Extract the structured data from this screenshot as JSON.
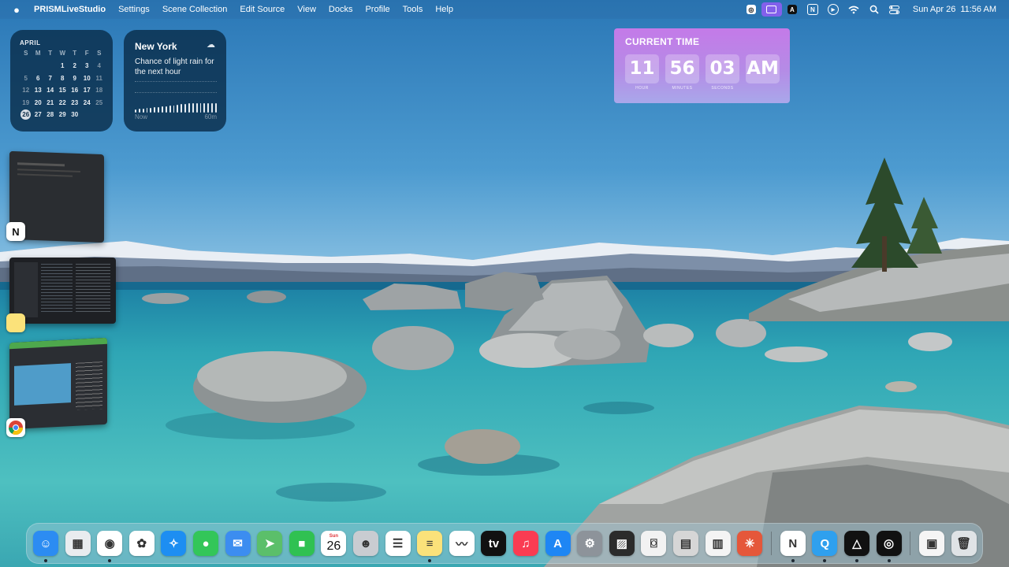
{
  "menubar": {
    "apple_icon": "apple-logo",
    "app_name": "PRISMLiveStudio",
    "items": [
      "Settings",
      "Scene Collection",
      "Edit Source",
      "View",
      "Docks",
      "Profile",
      "Tools",
      "Help"
    ],
    "status_icons": [
      "prism-icon",
      "screen-share-icon",
      "adobe-icon",
      "notion-icon",
      "play-circle-icon",
      "wifi-icon",
      "search-icon",
      "control-center-icon"
    ],
    "date": "Sun Apr 26",
    "time": "11:56 AM"
  },
  "calendar_widget": {
    "month": "APRIL",
    "weekdays": [
      "S",
      "M",
      "T",
      "W",
      "T",
      "F",
      "S"
    ],
    "days": [
      "",
      "",
      "",
      "1",
      "2",
      "3",
      "4",
      "5",
      "6",
      "7",
      "8",
      "9",
      "10",
      "11",
      "12",
      "13",
      "14",
      "15",
      "16",
      "17",
      "18",
      "19",
      "20",
      "21",
      "22",
      "23",
      "24",
      "25",
      "26",
      "27",
      "28",
      "29",
      "30"
    ],
    "today": "26"
  },
  "weather_widget": {
    "city": "New York",
    "forecast": "Chance of light rain for the next hour",
    "icon": "cloud-rain-icon",
    "start_label": "Now",
    "end_label": "60m"
  },
  "clock_widget": {
    "title": "CURRENT TIME",
    "hour": "11",
    "minutes": "56",
    "seconds": "03",
    "ampm": "AM",
    "hour_caption": "HOUR",
    "minutes_caption": "MINUTES",
    "seconds_caption": "SECONDS"
  },
  "stage_manager": {
    "apps": [
      "Notion",
      "Notes",
      "Chrome"
    ]
  },
  "dock": {
    "apps": [
      {
        "name": "Finder",
        "icon": "finder-icon",
        "color": "#2c8cf2",
        "glyph": "☺",
        "running": true
      },
      {
        "name": "Launchpad",
        "icon": "launchpad-icon",
        "color": "#e9ecef",
        "glyph": "▦",
        "running": false
      },
      {
        "name": "Chrome",
        "icon": "chrome-icon",
        "color": "#ffffff",
        "glyph": "◉",
        "running": true
      },
      {
        "name": "Photos",
        "icon": "photos-icon",
        "color": "#ffffff",
        "glyph": "✿",
        "running": false
      },
      {
        "name": "Safari",
        "icon": "safari-icon",
        "color": "#1d8ef2",
        "glyph": "✧",
        "running": false
      },
      {
        "name": "Messages",
        "icon": "messages-icon",
        "color": "#33c659",
        "glyph": "●",
        "running": false
      },
      {
        "name": "Mail",
        "icon": "mail-icon",
        "color": "#3c8df0",
        "glyph": "✉",
        "running": false
      },
      {
        "name": "Maps",
        "icon": "maps-icon",
        "color": "#5bbf6a",
        "glyph": "➤",
        "running": false
      },
      {
        "name": "FaceTime",
        "icon": "facetime-icon",
        "color": "#30c152",
        "glyph": "■",
        "running": false
      },
      {
        "name": "Calendar",
        "icon": "calendar-icon",
        "color": "#ffffff",
        "glyph": "26",
        "month": "Sun",
        "running": false
      },
      {
        "name": "Contacts",
        "icon": "contacts-icon",
        "color": "#c9ccd1",
        "glyph": "☻",
        "running": false
      },
      {
        "name": "Reminders",
        "icon": "reminders-icon",
        "color": "#ffffff",
        "glyph": "☰",
        "running": false
      },
      {
        "name": "Notes",
        "icon": "notes-icon",
        "color": "#fbe27a",
        "glyph": "≡",
        "running": true
      },
      {
        "name": "Freeform",
        "icon": "freeform-icon",
        "color": "#ffffff",
        "glyph": "〰",
        "running": false
      },
      {
        "name": "TV",
        "icon": "apple-tv-icon",
        "color": "#111111",
        "glyph": "tv",
        "running": false
      },
      {
        "name": "Music",
        "icon": "music-icon",
        "color": "#fa3c52",
        "glyph": "♫",
        "running": false
      },
      {
        "name": "App Store",
        "icon": "app-store-icon",
        "color": "#1e86f4",
        "glyph": "A",
        "running": false
      },
      {
        "name": "System Settings",
        "icon": "system-settings-icon",
        "color": "#8d939a",
        "glyph": "⚙",
        "running": false
      },
      {
        "name": "Color Picker",
        "icon": "color-picker-icon",
        "color": "#2b2b2b",
        "glyph": "▨",
        "running": false
      },
      {
        "name": "Screenshot",
        "icon": "screenshot-icon",
        "color": "#f2f2f2",
        "glyph": "⌼",
        "running": false
      },
      {
        "name": "Calculator",
        "icon": "calculator-icon",
        "color": "#d6d6d6",
        "glyph": "▤",
        "running": false
      },
      {
        "name": "Final Cut",
        "icon": "clapper-icon",
        "color": "#f4f4f4",
        "glyph": "▥",
        "running": false
      },
      {
        "name": "Claude",
        "icon": "claude-icon",
        "color": "#e5573a",
        "glyph": "✳",
        "running": false
      },
      {
        "name": "Notion",
        "icon": "notion-icon",
        "color": "#ffffff",
        "glyph": "N",
        "running": true
      },
      {
        "name": "QuickTime",
        "icon": "quicktime-icon",
        "color": "#2fa0ee",
        "glyph": "Q",
        "running": true
      },
      {
        "name": "Affinity",
        "icon": "affinity-icon",
        "color": "#111111",
        "glyph": "△",
        "running": true
      },
      {
        "name": "PRISM",
        "icon": "prism-live-icon",
        "color": "#111111",
        "glyph": "◎",
        "running": true
      },
      {
        "name": "Documents",
        "icon": "pdf-document-icon",
        "color": "#f5f5f5",
        "glyph": "▣",
        "running": false
      },
      {
        "name": "Trash",
        "icon": "trash-icon",
        "color": "#dfe3e6",
        "glyph": "🗑",
        "running": false
      }
    ]
  }
}
